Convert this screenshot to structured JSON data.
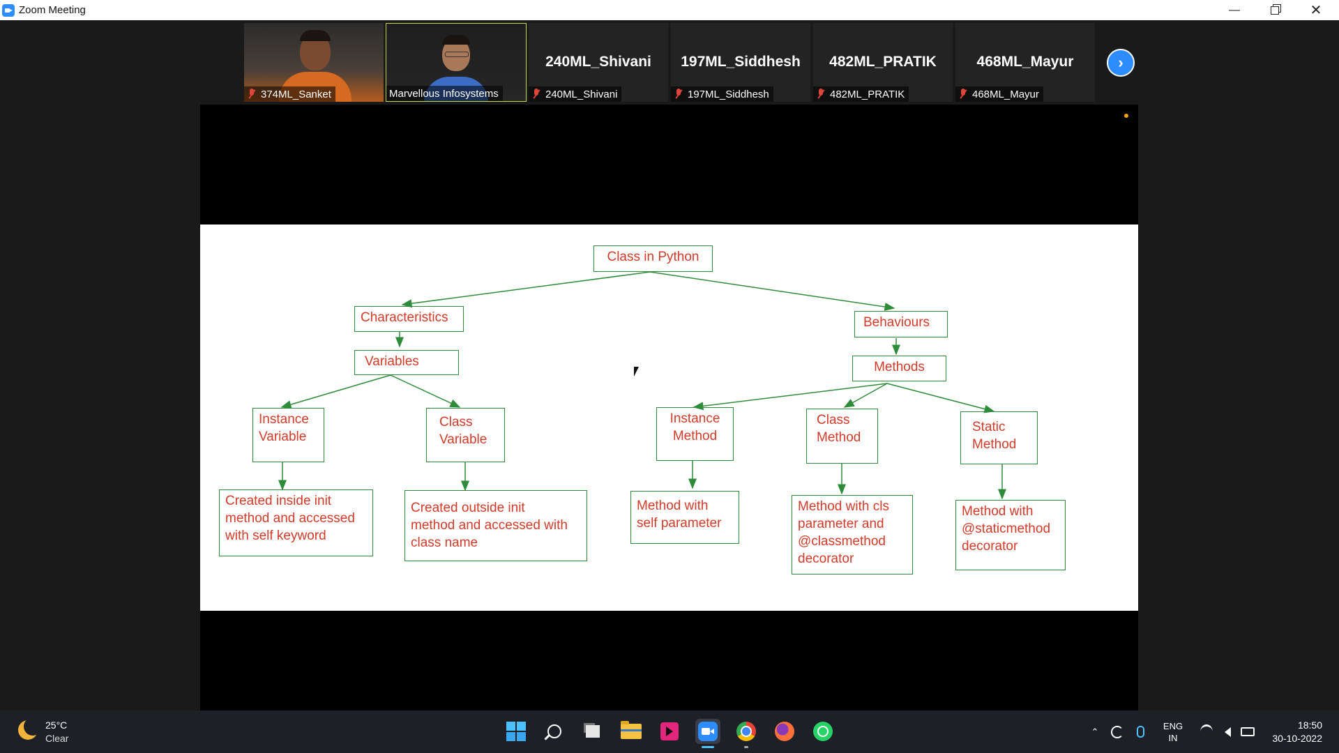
{
  "window": {
    "title": "Zoom Meeting",
    "minimize_icon": "minimize-icon",
    "restore_icon": "restore-icon",
    "close_icon": "close-icon"
  },
  "gallery": {
    "participants": [
      {
        "name": "374ML_Sanket",
        "video": true,
        "muted": true
      },
      {
        "name": "Marvellous Infosystems",
        "video": true,
        "muted": false,
        "active_speaker": true
      },
      {
        "name": "240ML_Shivani",
        "display_name": "240ML_Shivani",
        "video": false,
        "muted": true
      },
      {
        "name": "197ML_Siddhesh",
        "display_name": "197ML_Siddhesh",
        "video": false,
        "muted": true
      },
      {
        "name": "482ML_PRATIK",
        "display_name": "482ML_PRATIK",
        "video": false,
        "muted": true
      },
      {
        "name": "468ML_Mayur",
        "display_name": "468ML_Mayur",
        "video": false,
        "muted": true
      }
    ],
    "next_page_icon": "chevron-right-icon"
  },
  "diagram": {
    "root": "Class in Python",
    "characteristics": "Characteristics",
    "variables": "Variables",
    "instance_variable": "Instance\nVariable",
    "class_variable": "Class\nVariable",
    "instance_variable_desc": "Created inside init\nmethod and accessed\nwith self keyword",
    "class_variable_desc": "Created outside init\nmethod and accessed with\nclass name",
    "behaviours": "Behaviours",
    "methods": "Methods",
    "instance_method": "Instance\nMethod",
    "class_method": "Class\nMethod",
    "static_method": "Static\nMethod",
    "instance_method_desc": "Method with\nself parameter",
    "class_method_desc": "Method with cls\nparameter and\n@classmethod\ndecorator",
    "static_method_desc": "Method with\n@staticmethod\ndecorator",
    "box_color": "#2e8b3a",
    "text_color": "#d13b2a"
  },
  "taskbar": {
    "weather": {
      "temp": "25°C",
      "condition": "Clear",
      "icon": "moon-icon"
    },
    "apps": [
      "windows-start-icon",
      "search-icon",
      "task-view-icon",
      "file-explorer-icon",
      "video-editor-icon",
      "zoom-icon",
      "chrome-icon",
      "firefox-icon",
      "whatsapp-icon"
    ],
    "tray": {
      "lang_line1": "ENG",
      "lang_line2": "IN"
    },
    "clock": {
      "time": "18:50",
      "date": "30-10-2022"
    }
  }
}
